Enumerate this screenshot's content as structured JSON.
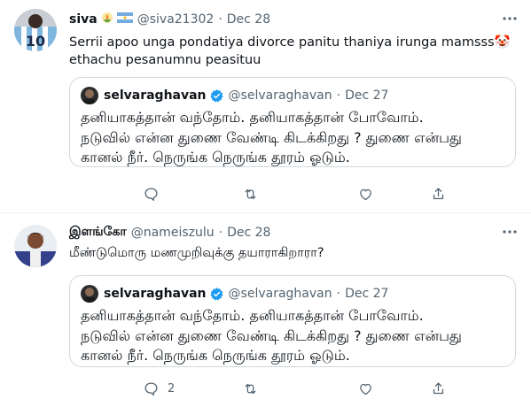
{
  "tweets": [
    {
      "author": {
        "name": "siva",
        "handle": "@siva21302",
        "flair_icons": [
          "lotus-icon",
          "argentina-flag-icon"
        ]
      },
      "date": "Dec 28",
      "separator": "·",
      "text": "Serrii apoo unga pondatiya divorce panitu thaniya irunga mamsss🤡 ethachu pesanumnu peasituu",
      "quote": {
        "author": {
          "name": "selvaraghavan",
          "handle": "@selvaraghavan",
          "verified": true
        },
        "date": "Dec 27",
        "separator": "·",
        "lines": [
          "தனியாகத்தான் வந்தோம். தனியாகத்தான் போவோம்.",
          "நடுவில் என்ன துணை வேண்டி கிடக்கிறது ? துணை என்பது",
          "கானல் நீர். நெருங்க நெருங்க தூரம் ஓடும்."
        ]
      },
      "actions": {
        "reply": "",
        "retweet": "",
        "like": "",
        "share": ""
      }
    },
    {
      "author": {
        "name": "இளங்கோ",
        "handle": "@nameiszulu"
      },
      "date": "Dec 28",
      "separator": "·",
      "text": "மீண்டுமொரு மணமுறிவுக்கு தயாராகிறாரா?",
      "quote": {
        "author": {
          "name": "selvaraghavan",
          "handle": "@selvaraghavan",
          "verified": true
        },
        "date": "Dec 27",
        "separator": "·",
        "lines": [
          "தனியாகத்தான் வந்தோம். தனியாகத்தான் போவோம்.",
          "நடுவில் என்ன துணை வேண்டி கிடக்கிறது ? துணை என்பது",
          "கானல் நீர். நெருங்க நெருங்க தூரம் ஓடும்."
        ]
      },
      "actions": {
        "reply": "2",
        "retweet": "",
        "like": "",
        "share": ""
      }
    }
  ],
  "more_icon": "more-horizontal-icon",
  "colors": {
    "text": "#0f1419",
    "muted": "#536471",
    "border": "#cfd9de",
    "verified": "#1d9bf0"
  }
}
